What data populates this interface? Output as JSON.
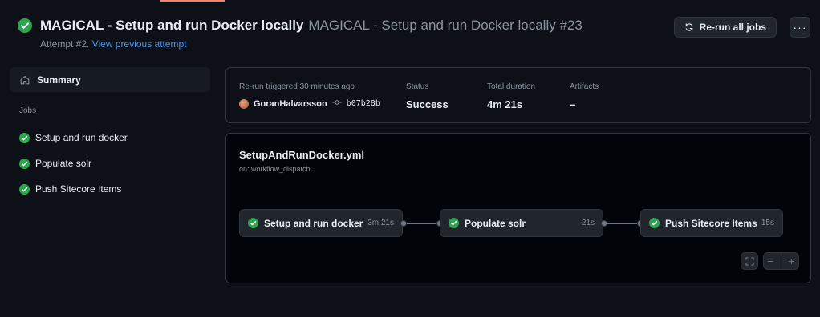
{
  "header": {
    "title": "MAGICAL - Setup and run Docker locally",
    "subtitle": "MAGICAL - Setup and run Docker locally #23",
    "attempt_text": "Attempt #2.",
    "attempt_link": "View previous attempt",
    "rerun_label": "Re-run all jobs",
    "more_label": "···"
  },
  "sidebar": {
    "summary_label": "Summary",
    "jobs_label": "Jobs",
    "jobs": [
      {
        "label": "Setup and run docker"
      },
      {
        "label": "Populate solr"
      },
      {
        "label": "Push Sitecore Items"
      }
    ]
  },
  "run_info": {
    "trigger_label": "Re-run triggered 30 minutes ago",
    "actor": "GoranHalvarsson",
    "commit": "b07b28b",
    "status_label": "Status",
    "status_value": "Success",
    "duration_label": "Total duration",
    "duration_value": "4m 21s",
    "artifacts_label": "Artifacts",
    "artifacts_value": "–"
  },
  "workflow": {
    "file": "SetupAndRunDocker.yml",
    "trigger": "on: workflow_dispatch",
    "jobs": [
      {
        "label": "Setup and run docker",
        "duration": "3m 21s"
      },
      {
        "label": "Populate solr",
        "duration": "21s"
      },
      {
        "label": "Push Sitecore Items",
        "duration": "15s"
      }
    ],
    "zoom_out": "−",
    "zoom_in": "+"
  },
  "colors": {
    "success": "#2da44e",
    "link": "#4493f8",
    "background": "#0d1117"
  }
}
